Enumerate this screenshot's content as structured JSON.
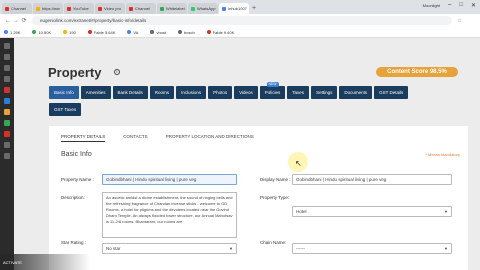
{
  "browser": {
    "tabs": [
      {
        "label": "Channel",
        "color": "#d93025",
        "active": false
      },
      {
        "label": "https://ww",
        "color": "#f4b400",
        "active": false
      },
      {
        "label": "YouTube",
        "color": "#d93025",
        "active": false
      },
      {
        "label": "Video pro",
        "color": "#d93025",
        "active": false
      },
      {
        "label": "Channel",
        "color": "#d93025",
        "active": false
      },
      {
        "label": "Whitelabel",
        "color": "#34a853",
        "active": false
      },
      {
        "label": "WhatsApp",
        "color": "#25d366",
        "active": false
      },
      {
        "label": "Inhub1007",
        "color": "#4285f4",
        "active": true
      }
    ],
    "url": "eugeniolink.com/extranet/#/property/basic-info/details",
    "bookmarks": [
      "1.29K",
      "10.50K",
      "190",
      "Fable 5.64K",
      "VA",
      "vhost",
      "bosch",
      "Fable 9.40K"
    ],
    "bookmarks_right": "Moonlight"
  },
  "page": {
    "title": "Property",
    "score": "Content Score 98.5%",
    "buttons_row1": [
      "Basic Info",
      "Amenities",
      "Bank Details",
      "Rooms",
      "Inclusions",
      "Photos",
      "Videos",
      "Policies",
      "Taxes",
      "Settings",
      "Documents",
      "GST Details"
    ],
    "new_badge": "NEW",
    "buttons_row2": [
      "GST Taxes"
    ],
    "subtabs": [
      "PROPERTY DETAILS",
      "CONTACTS",
      "PROPERTY LOCATION AND DIRECTIONS"
    ],
    "section": "Basic Info",
    "required": "* Means Mandatory",
    "fields": {
      "property_name_label": "Property Name :",
      "property_name_value": "Gobindbhani | Hindu spiritual living | pure veg",
      "display_name_label": "Display Name :",
      "display_name_value": "Gobindbhani | Hindu spiritual living | pure veg",
      "description_label": "Description:",
      "description_value": "An ascetic amidst a divine establishment, the sound of ringing bells and the refreshing fragrance of Chandan incense sticks - welcome to GD Rooms, a hotel for pilgrims and the devotees located near the Govind Dham Temple. An always flooded tower structure, our Annual Mahotsav is 11-2/8 rooms. Bhantaram, our rooms are",
      "property_type_label": "Property Type:",
      "property_type_value": "Hotel",
      "star_rating_label": "Star Rating :",
      "star_rating_value": "No star",
      "chain_name_label": "Chain Name:",
      "chain_name_value": "------"
    }
  },
  "taskbar": {
    "label": "ACTIVATE"
  }
}
